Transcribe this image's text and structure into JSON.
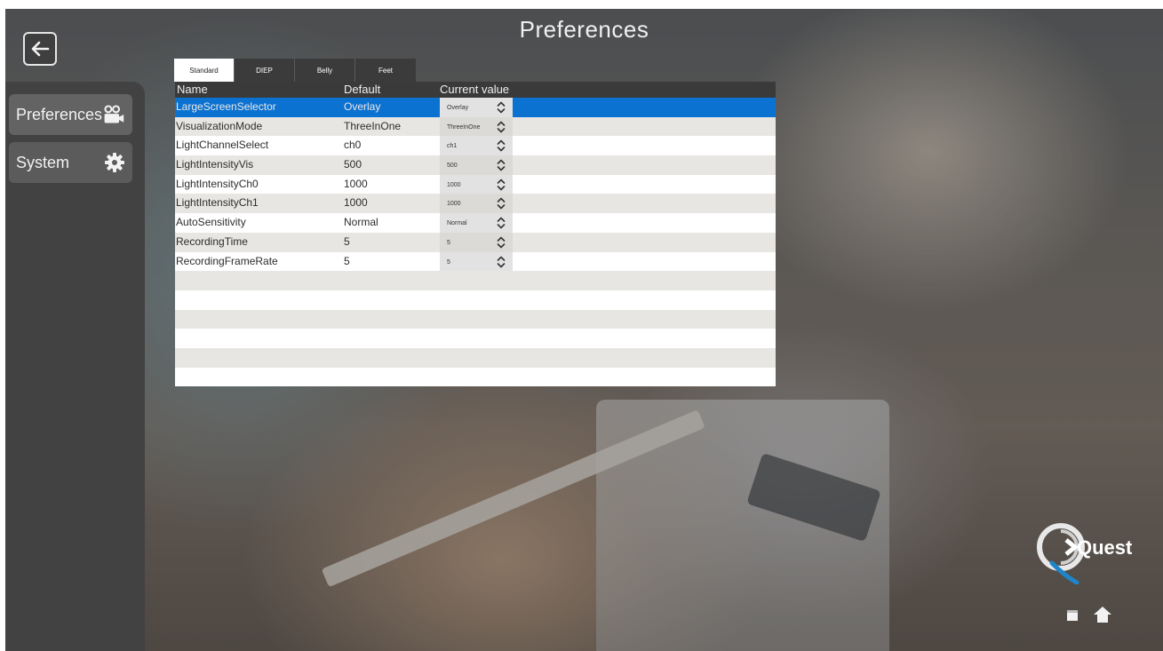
{
  "page_title": "Preferences",
  "sidebar": {
    "items": [
      {
        "label": "Preferences",
        "icon": "video-camera-icon",
        "active": true
      },
      {
        "label": "System",
        "icon": "gear-icon",
        "active": false
      }
    ]
  },
  "tabs": [
    {
      "label": "Standard",
      "active": true
    },
    {
      "label": "DIEP",
      "active": false
    },
    {
      "label": "Belly",
      "active": false
    },
    {
      "label": "Feet",
      "active": false
    }
  ],
  "table": {
    "headers": {
      "name": "Name",
      "default": "Default",
      "current": "Current value"
    },
    "rows": [
      {
        "name": "LargeScreenSelector",
        "default": "Overlay",
        "current": "Overlay",
        "selected": true
      },
      {
        "name": "VisualizationMode",
        "default": "ThreeInOne",
        "current": "ThreeInOne",
        "selected": false
      },
      {
        "name": "LightChannelSelect",
        "default": "ch0",
        "current": "ch1",
        "selected": false
      },
      {
        "name": "LightIntensityVis",
        "default": "500",
        "current": "500",
        "selected": false
      },
      {
        "name": "LightIntensityCh0",
        "default": "1000",
        "current": "1000",
        "selected": false
      },
      {
        "name": "LightIntensityCh1",
        "default": "1000",
        "current": "1000",
        "selected": false
      },
      {
        "name": "AutoSensitivity",
        "default": "Normal",
        "current": "Normal",
        "selected": false
      },
      {
        "name": "RecordingTime",
        "default": "5",
        "current": "5",
        "selected": false
      },
      {
        "name": "RecordingFrameRate",
        "default": "5",
        "current": "5",
        "selected": false
      }
    ]
  },
  "logo_text": "Quest",
  "colors": {
    "selection": "#0c72d1",
    "panel": "#424242",
    "header": "#3a3a3a"
  }
}
